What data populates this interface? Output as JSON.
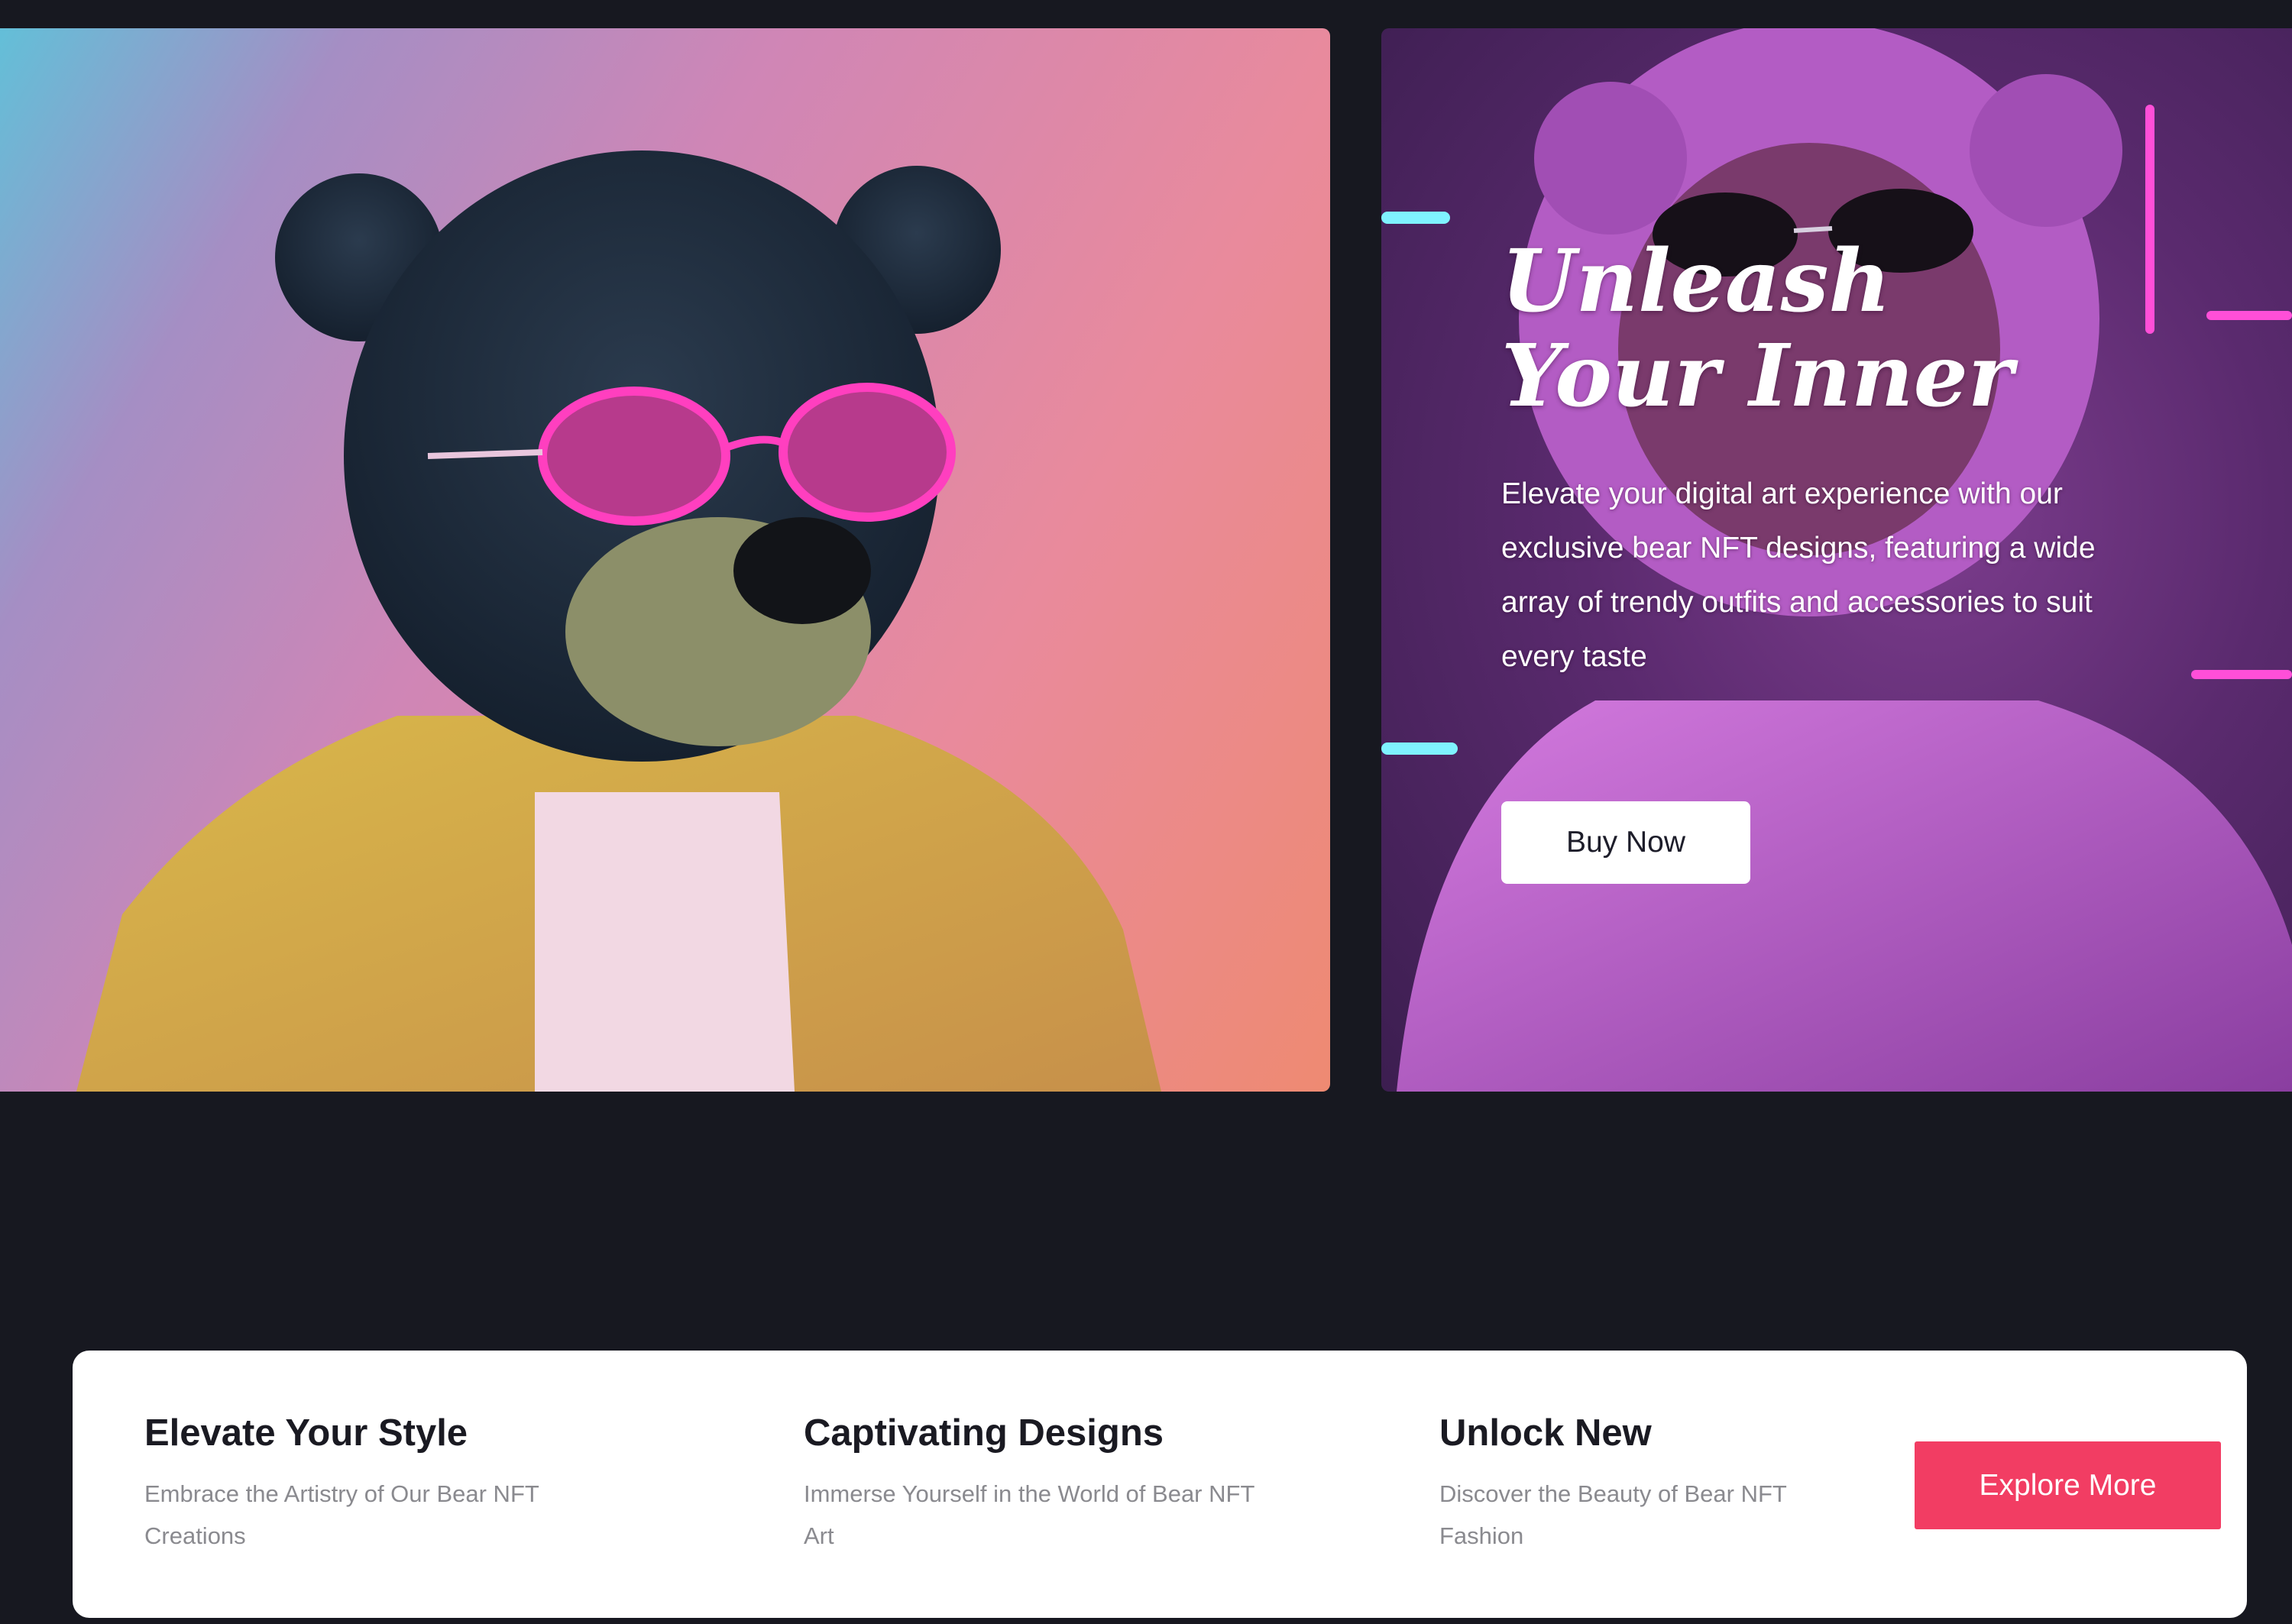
{
  "hero": {
    "title": "Unleash Your Inner",
    "description": "Elevate your digital art experience with our exclusive bear NFT designs, featuring a wide array of trendy outfits and accessories to suit every taste",
    "cta_label": "Buy Now"
  },
  "images": {
    "left": "bear-yellow-jacket-pink-sunglasses",
    "right": "bear-pink-hoodie-neon"
  },
  "features": [
    {
      "title": "Elevate Your Style",
      "description": "Embrace the Artistry of Our Bear NFT Creations"
    },
    {
      "title": "Captivating Designs",
      "description": "Immerse Yourself in the World of Bear NFT Art"
    },
    {
      "title": "Unlock New",
      "description": "Discover the Beauty of Bear NFT Fashion"
    }
  ],
  "explore_label": "Explore More",
  "colors": {
    "page_background": "#171820",
    "accent": "#f23d63",
    "card_background": "#ffffff"
  }
}
